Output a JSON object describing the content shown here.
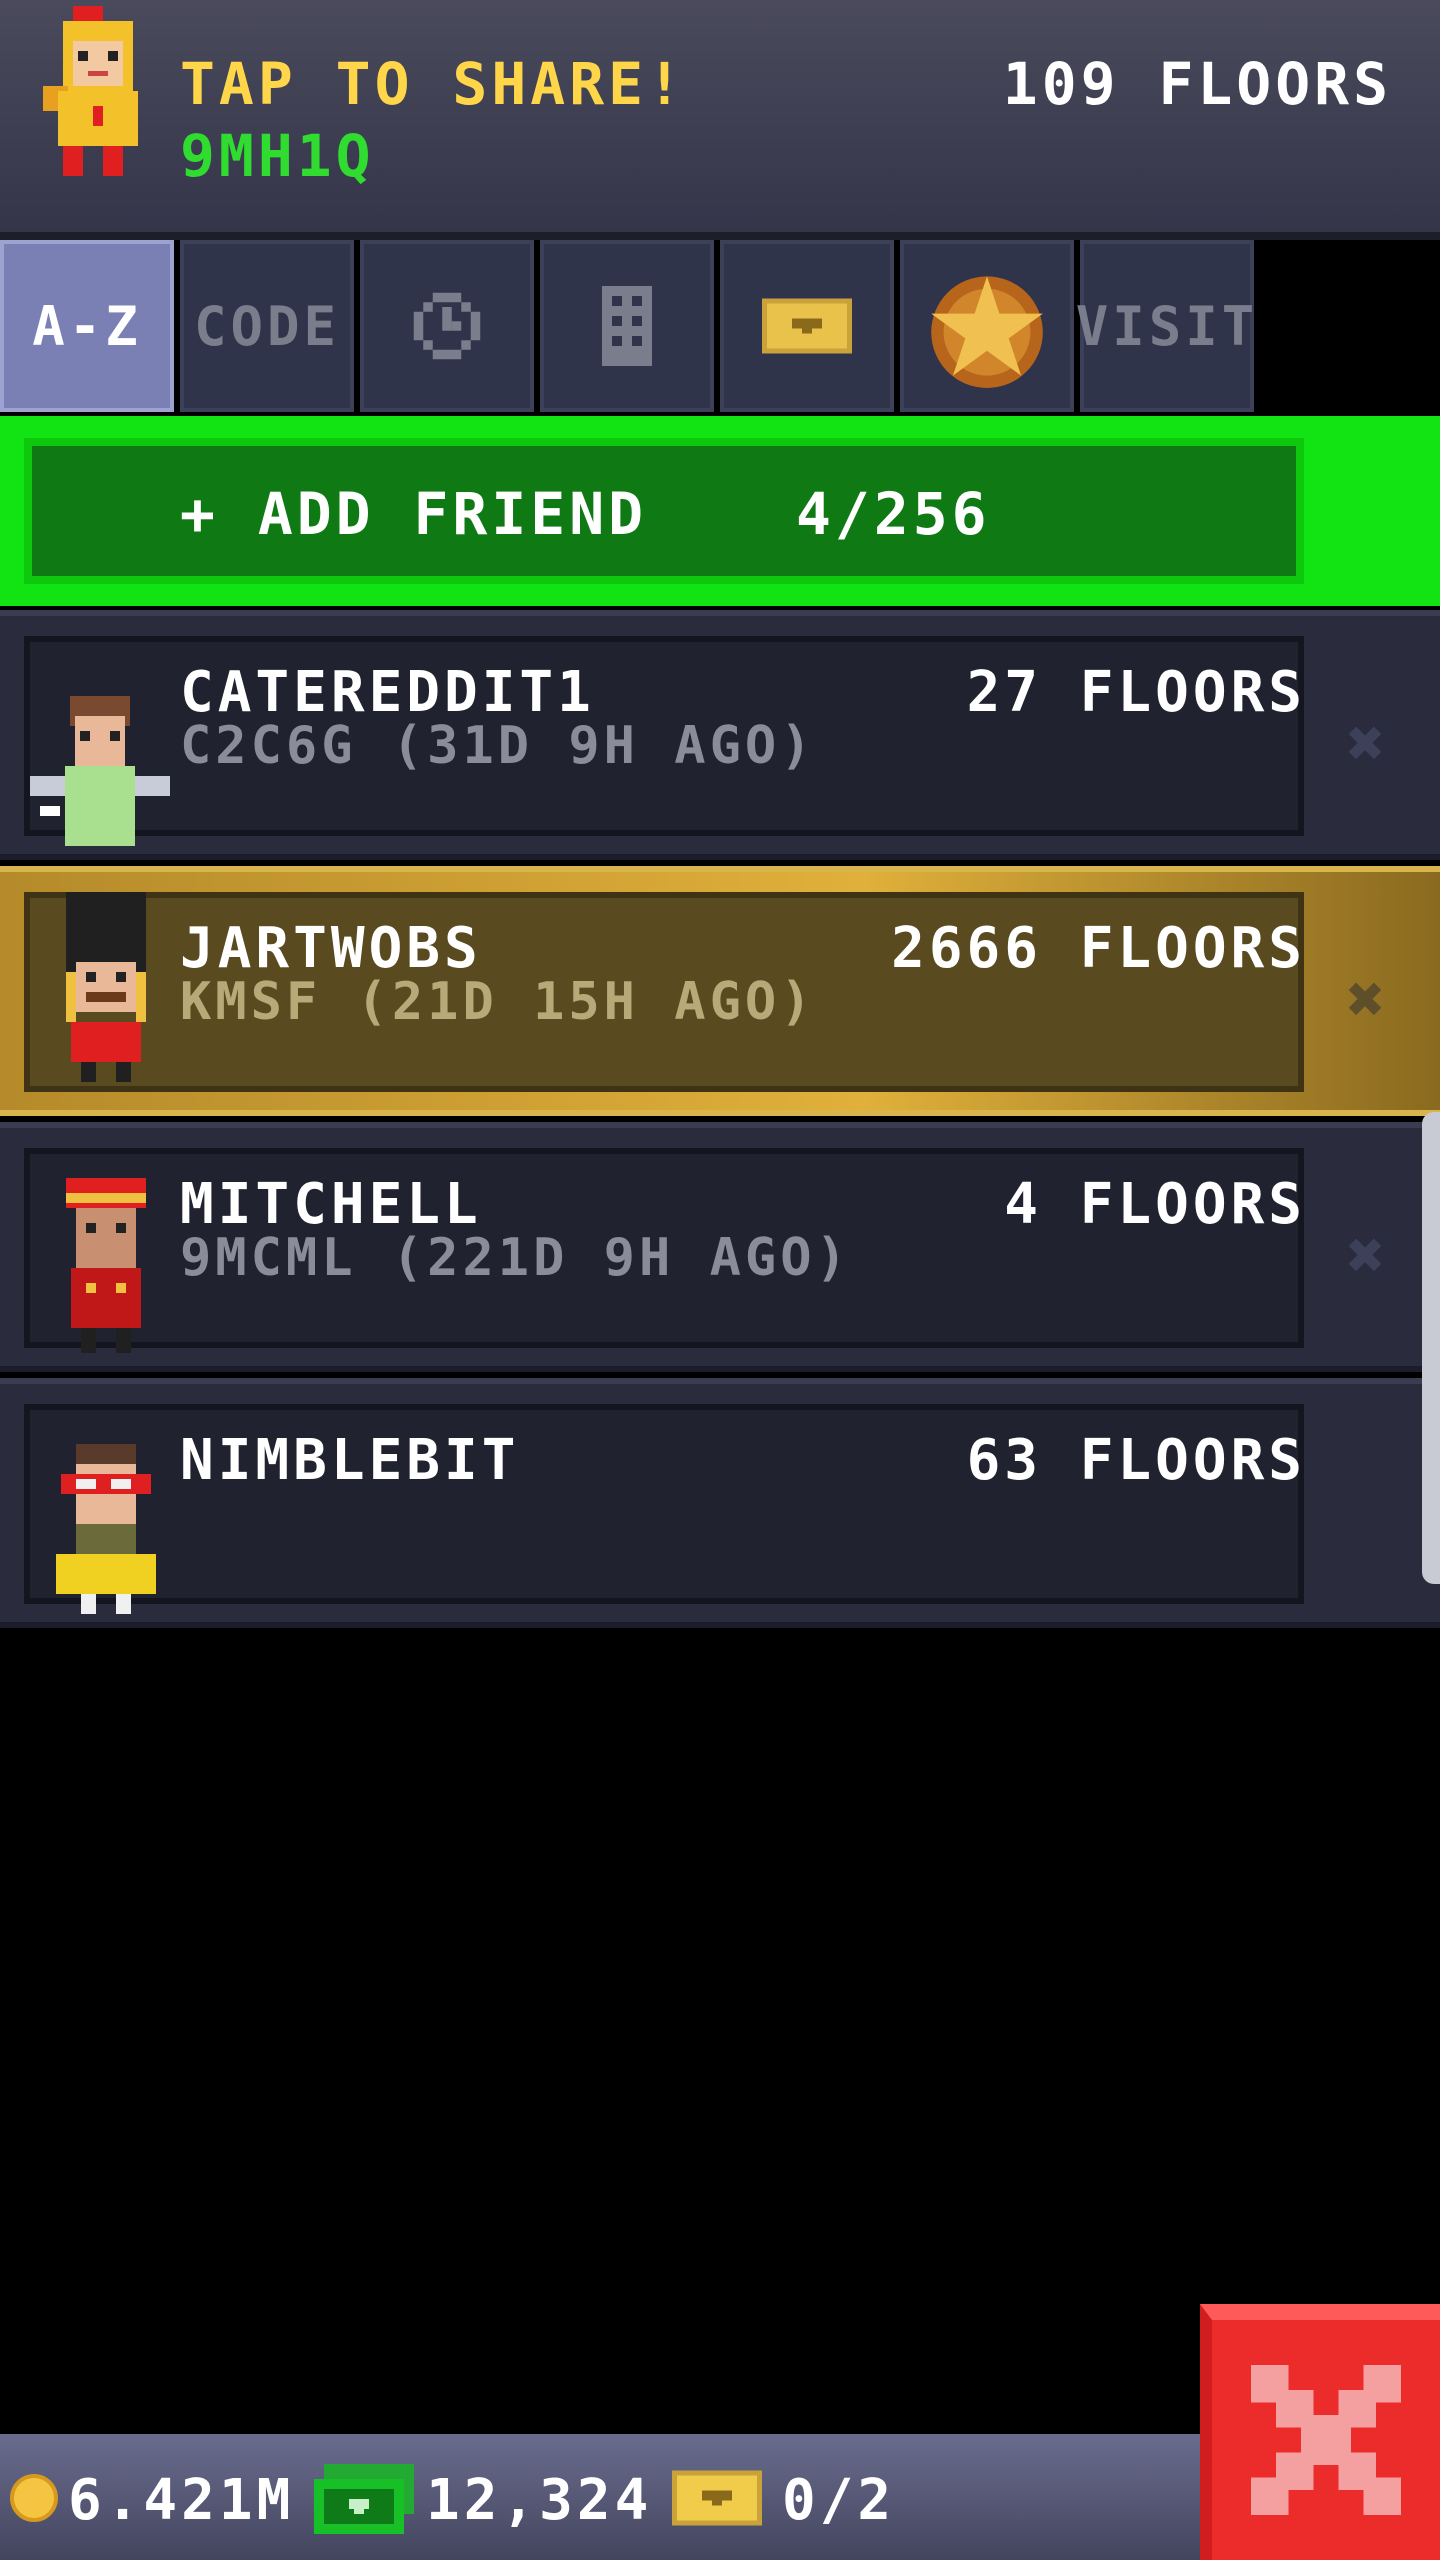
{
  "header": {
    "share_label": "TAP TO SHARE!",
    "share_code": "9MH1Q",
    "floors": "109 FLOORS"
  },
  "tabs": [
    {
      "label": "A-Z",
      "active": true
    },
    {
      "label": "CODE",
      "active": false
    },
    {
      "icon": "clock-icon",
      "active": false
    },
    {
      "icon": "building-icon",
      "active": false
    },
    {
      "icon": "golden-ticket-icon",
      "active": false
    },
    {
      "icon": "star-medal-icon",
      "active": false
    },
    {
      "label": "VISIT",
      "active": false
    }
  ],
  "add_friend": {
    "label": "+ ADD FRIEND",
    "count": "4/256"
  },
  "friends": [
    {
      "name": "CATEREDDIT1",
      "floors": "27 FLOORS",
      "sub": "C2C6G (31D 9H AGO)",
      "highlight": false
    },
    {
      "name": "JARTWOBS",
      "floors": "2666 FLOORS",
      "sub": "KMSF (21D 15H AGO)",
      "highlight": true
    },
    {
      "name": "MITCHELL",
      "floors": "4 FLOORS",
      "sub": "9MCML (221D 9H AGO)",
      "highlight": false
    },
    {
      "name": "NIMBLEBIT",
      "floors": "63 FLOORS",
      "sub": "",
      "highlight": false
    }
  ],
  "bottom_bar": {
    "coins": "6.421M",
    "bux": "12,324",
    "tickets": "0/2"
  },
  "colors": {
    "accent_green": "#12e312",
    "share_yellow": "#ffd64a",
    "code_green": "#2fdc2f",
    "close_red": "#ec2b2b",
    "highlight_gold": "#e0b03a"
  }
}
